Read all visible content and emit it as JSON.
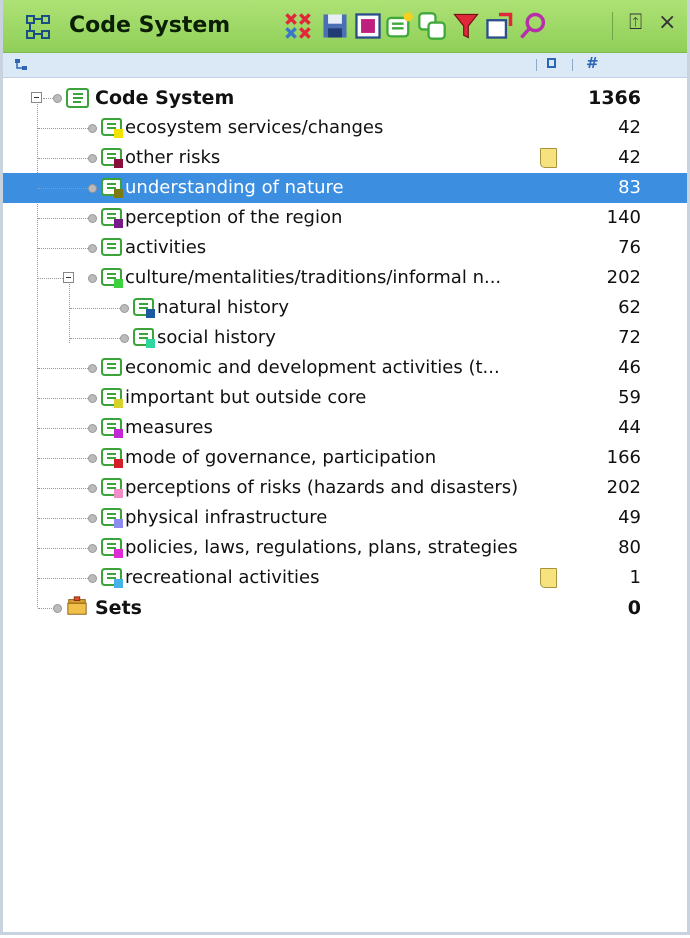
{
  "titlebar": {
    "title": "Code System",
    "title_icon": "code-system-icon",
    "toolbar": [
      {
        "name": "activate-codes-icon",
        "color": "#e0283a"
      },
      {
        "name": "save-icon",
        "color": "#4b6fb5"
      },
      {
        "name": "export-icon",
        "color": "#c0207d"
      },
      {
        "name": "new-code-icon",
        "color": "#3fa83a"
      },
      {
        "name": "code-set-icon",
        "color": "#3fa83a"
      },
      {
        "name": "filter-icon",
        "color": "#e0283a"
      },
      {
        "name": "import-icon",
        "color": "#e0283a"
      },
      {
        "name": "search-icon",
        "color": "#b62ea8"
      }
    ],
    "window_buttons": {
      "pin": "⍐",
      "close": "×"
    }
  },
  "columns": {
    "memo_icon": "memo-column-icon",
    "count_label": "#"
  },
  "tree": {
    "root": {
      "label": "Code System",
      "count": "1366"
    },
    "items": [
      {
        "label": "ecosystem services/changes",
        "count": "42",
        "color": "#f2e200",
        "memo": false,
        "selected": false,
        "level": 1
      },
      {
        "label": "other risks",
        "count": "42",
        "color": "#8a0f3a",
        "memo": true,
        "selected": false,
        "level": 1
      },
      {
        "label": "understanding of nature",
        "count": "83",
        "color": "#7c7a12",
        "memo": false,
        "selected": true,
        "level": 1
      },
      {
        "label": "perception of the region",
        "count": "140",
        "color": "#7a1b8a",
        "memo": false,
        "selected": false,
        "level": 1
      },
      {
        "label": "activities",
        "count": "76",
        "color": "",
        "memo": false,
        "selected": false,
        "level": 1
      },
      {
        "label": "culture/mentalities/traditions/informal n...",
        "count": "202",
        "color": "#3bd23b",
        "memo": false,
        "selected": false,
        "level": 1,
        "expanded": true
      },
      {
        "label": "natural history",
        "count": "62",
        "color": "#1a5a9e",
        "memo": false,
        "selected": false,
        "level": 2
      },
      {
        "label": "social history",
        "count": "72",
        "color": "#2ed6a0",
        "memo": false,
        "selected": false,
        "level": 2
      },
      {
        "label": "economic and development activities (t...",
        "count": "46",
        "color": "",
        "memo": false,
        "selected": false,
        "level": 1
      },
      {
        "label": "important but outside core",
        "count": "59",
        "color": "#d6d22a",
        "memo": false,
        "selected": false,
        "level": 1
      },
      {
        "label": "measures",
        "count": "44",
        "color": "#c127d2",
        "memo": false,
        "selected": false,
        "level": 1
      },
      {
        "label": "mode of governance, participation",
        "count": "166",
        "color": "#d41f2b",
        "memo": false,
        "selected": false,
        "level": 1
      },
      {
        "label": "perceptions of risks (hazards and disasters)",
        "count": "202",
        "color": "#f28cc8",
        "memo": false,
        "selected": false,
        "level": 1
      },
      {
        "label": "physical infrastructure",
        "count": "49",
        "color": "#8c8cf0",
        "memo": false,
        "selected": false,
        "level": 1
      },
      {
        "label": "policies, laws, regulations, plans, strategies",
        "count": "80",
        "color": "#e02ad6",
        "memo": false,
        "selected": false,
        "level": 1
      },
      {
        "label": "recreational activities",
        "count": "1",
        "color": "#47b2e8",
        "memo": true,
        "selected": false,
        "level": 1
      }
    ],
    "sets": {
      "label": "Sets",
      "count": "0",
      "icon": "sets-folder-icon"
    }
  },
  "colors": {
    "titlebar": "#a6dc6e",
    "selection": "#3b8ee0",
    "column_header": "#dbe8f6"
  }
}
